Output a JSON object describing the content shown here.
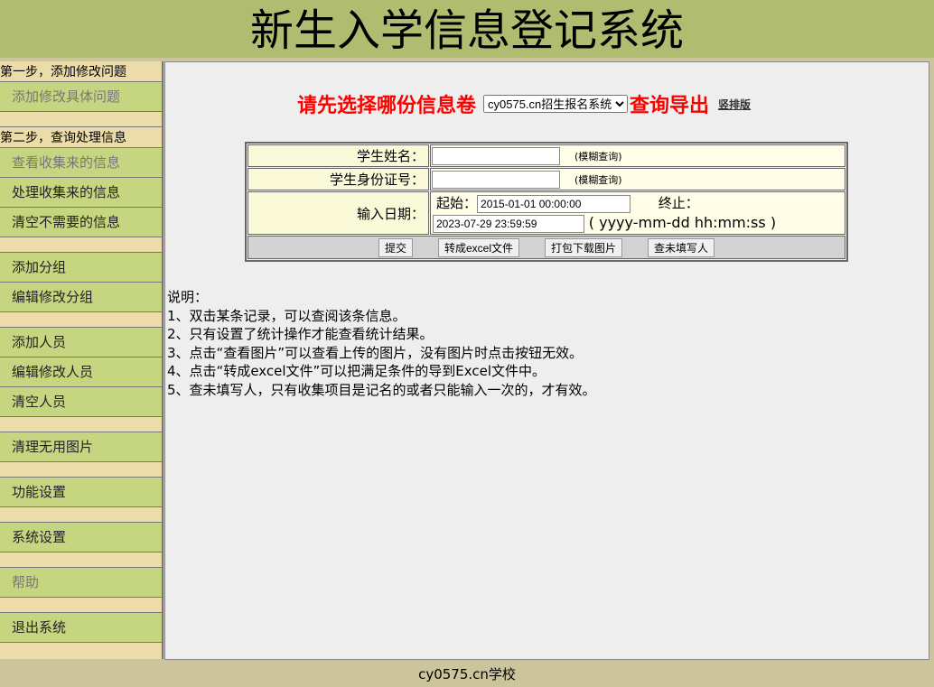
{
  "header": {
    "title": "新生入学信息登记系统"
  },
  "sidebar": [
    {
      "type": "h",
      "label": "第一步，添加修改问题"
    },
    {
      "type": "i",
      "label": "添加修改具体问题",
      "dim": true
    },
    {
      "type": "s"
    },
    {
      "type": "h",
      "label": "第二步，查询处理信息"
    },
    {
      "type": "i",
      "label": "查看收集来的信息",
      "dim": true
    },
    {
      "type": "i",
      "label": "处理收集来的信息"
    },
    {
      "type": "i",
      "label": "清空不需要的信息"
    },
    {
      "type": "s"
    },
    {
      "type": "i",
      "label": "添加分组"
    },
    {
      "type": "i",
      "label": "编辑修改分组"
    },
    {
      "type": "s"
    },
    {
      "type": "i",
      "label": "添加人员"
    },
    {
      "type": "i",
      "label": "编辑修改人员"
    },
    {
      "type": "i",
      "label": "清空人员"
    },
    {
      "type": "s"
    },
    {
      "type": "i",
      "label": "清理无用图片"
    },
    {
      "type": "s"
    },
    {
      "type": "i",
      "label": "功能设置"
    },
    {
      "type": "s"
    },
    {
      "type": "i",
      "label": "系统设置"
    },
    {
      "type": "s"
    },
    {
      "type": "i",
      "label": "帮助",
      "dim": true
    },
    {
      "type": "s"
    },
    {
      "type": "i",
      "label": "退出系统"
    }
  ],
  "main": {
    "prompt": "请先选择哪份信息卷",
    "survey_selected": "cy0575.cn招生报名系统",
    "query_export": "查询导出",
    "vertical_link": "竖排版",
    "form": {
      "name_label": "学生姓名：",
      "name_value": "",
      "fuzzy": "(模糊查询)",
      "id_label": "学生身份证号：",
      "id_value": "",
      "date_label": "输入日期：",
      "start_label": "起始：",
      "start_value": "2015-01-01 00:00:00",
      "end_label": "终止：",
      "end_value": "2023-07-29 23:59:59",
      "format_hint": "( yyyy-mm-dd hh:mm:ss )"
    },
    "buttons": {
      "submit": "提交",
      "excel": "转成excel文件",
      "download_images": "打包下载图片",
      "unfilled": "查未填写人"
    },
    "notes": [
      "说明：",
      "1、双击某条记录，可以查阅该条信息。",
      "2、只有设置了统计操作才能查看统计结果。",
      "3、点击“查看图片”可以查看上传的图片，没有图片时点击按钮无效。",
      "4、点击“转成excel文件”可以把满足条件的导到Excel文件中。",
      "5、查未填写人，只有收集项目是记名的或者只能输入一次的，才有效。"
    ]
  },
  "footer": {
    "text": "cy0575.cn学校"
  }
}
